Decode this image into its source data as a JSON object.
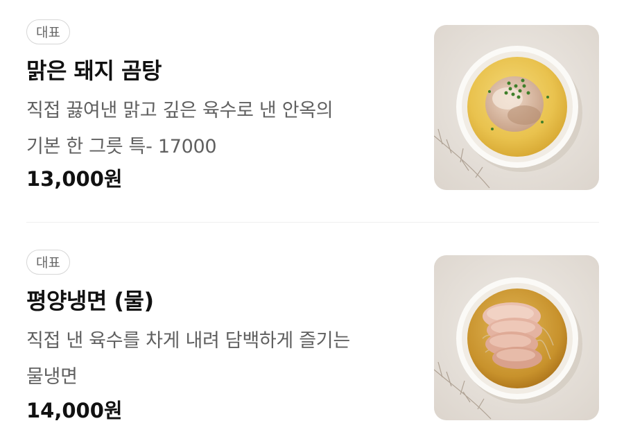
{
  "menu": {
    "items": [
      {
        "badge": "대표",
        "name": "맑은 돼지 곰탕",
        "description_lines": [
          "직접 끓여낸 맑고 깊은 육수로 낸 안옥의",
          "기본 한 그릇 특- 17000"
        ],
        "price": "13,000원",
        "image_icon": "pork-gomtang-bowl-image"
      },
      {
        "badge": "대표",
        "name": "평양냉면 (물)",
        "description_lines": [
          "직접 낸 육수를 차게 내려 담백하게 즐기는",
          "물냉면"
        ],
        "price": "14,000원",
        "image_icon": "pyongyang-naengmyeon-bowl-image"
      }
    ]
  },
  "colors": {
    "text_primary": "#111111",
    "text_secondary": "#606060",
    "badge_border": "#d6d6d6",
    "divider": "#eeeeee",
    "photo_background": "#e8e4df"
  }
}
